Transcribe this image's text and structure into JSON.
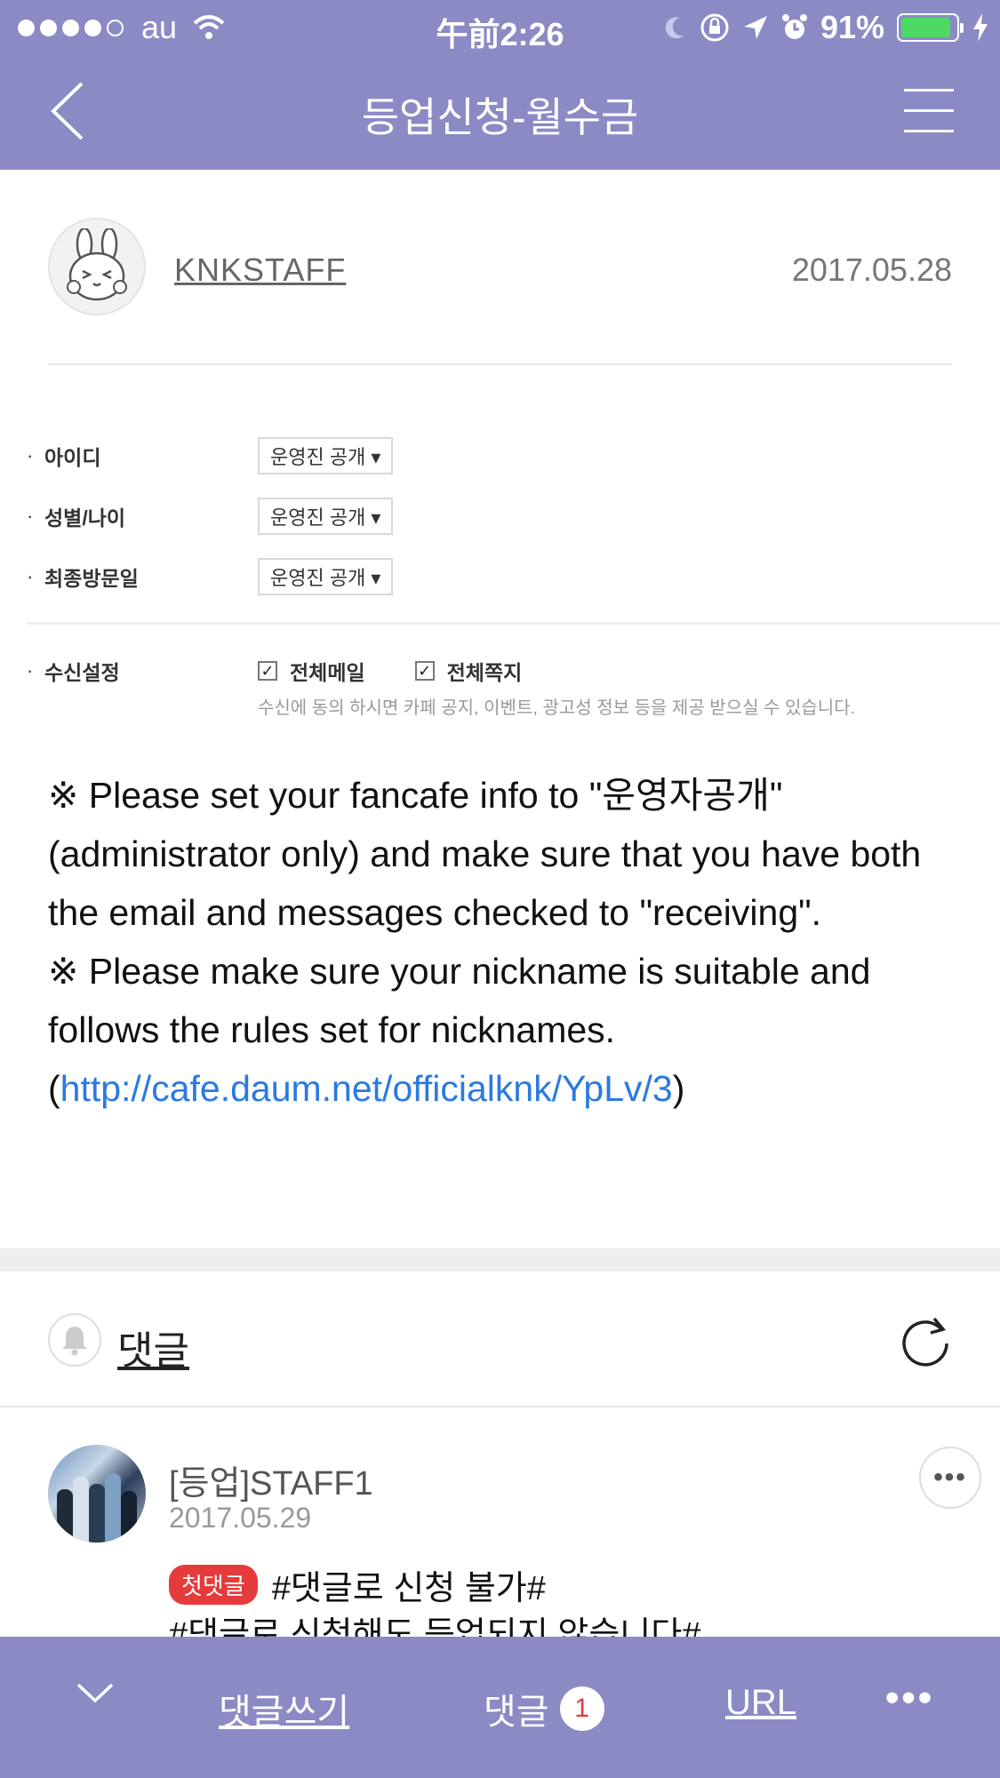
{
  "status_bar": {
    "carrier": "au",
    "time": "午前2:26",
    "battery": "91%",
    "battery_level": 0.91,
    "battery_color": "#4cd964"
  },
  "nav": {
    "title": "등업신청-월수금",
    "back_icon": "chevron-left-icon",
    "menu_icon": "hamburger-menu-icon"
  },
  "post": {
    "author": "KNKSTAFF",
    "date": "2017.05.28"
  },
  "settings_image": {
    "rows": [
      {
        "label": "아이디",
        "value": "운영진 공개 ▾"
      },
      {
        "label": "성별/나이",
        "value": "운영진 공개 ▾"
      },
      {
        "label": "최종방문일",
        "value": "운영진 공개 ▾"
      }
    ],
    "receive_label": "수신설정",
    "checkbox_mail": "전체메일",
    "checkbox_message": "전체쪽지",
    "notice": "수신에 동의 하시면 카페 공지, 이벤트, 광고성 정보 등을 제공 받으실 수 있습니다."
  },
  "body": {
    "para1": "※ Please set your fancafe info to \"운영자공개\" (administrator only) and make sure that you have both the email and messages checked to \"receiving\".",
    "para2_text": "※ Please make sure your nickname is suitable and follows the rules set for nicknames. (",
    "para2_link": "http://cafe.daum.net/officialknk/YpLv/3",
    "para2_end": ")",
    "link_color": "#2a7ae2"
  },
  "comments_header": {
    "label": "댓글",
    "bell_icon": "bell-icon",
    "refresh_icon": "refresh-icon"
  },
  "comment": {
    "author": "[등업]STAFF1",
    "date": "2017.05.29",
    "badge": "첫댓글",
    "line1": "#댓글로 신청 불가#",
    "line2": "#댓글로 신청해도 등업되지 않습니다#",
    "more_icon": "more-horizontal-icon"
  },
  "bottom_bar": {
    "down_icon": "chevron-down-icon",
    "write": "댓글쓰기",
    "comments": "댓글",
    "comment_count": "1",
    "url": "URL",
    "more_icon": "more-horizontal-icon"
  },
  "colors": {
    "header_bg": "#8b8ac5",
    "badge": "#e53b3b"
  }
}
